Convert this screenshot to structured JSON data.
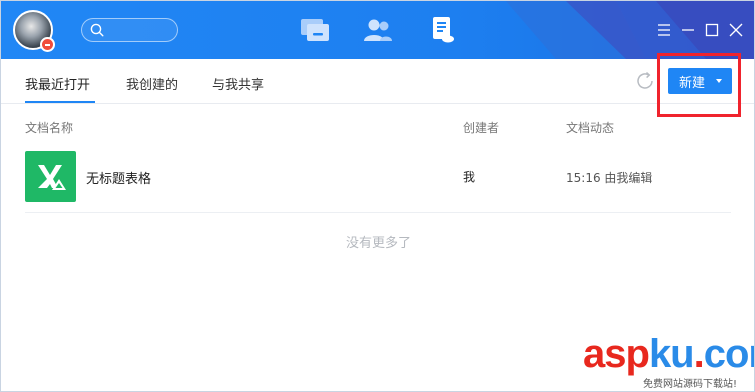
{
  "header": {
    "search": {
      "placeholder": ""
    },
    "nav": [
      {
        "icon": "message-icon",
        "active": false
      },
      {
        "icon": "contacts-icon",
        "active": false
      },
      {
        "icon": "document-icon",
        "active": true
      }
    ],
    "window_controls": [
      "menu-icon",
      "minimize-icon",
      "maximize-icon",
      "close-icon"
    ]
  },
  "tabs": [
    {
      "label": "我最近打开",
      "active": true
    },
    {
      "label": "我创建的",
      "active": false
    },
    {
      "label": "与我共享",
      "active": false
    }
  ],
  "toolbar": {
    "new_label": "新建"
  },
  "table": {
    "columns": [
      "文档名称",
      "创建者",
      "文档动态"
    ],
    "rows": [
      {
        "icon": "spreadsheet-icon",
        "name": "无标题表格",
        "creator": "我",
        "activity": "15:16 由我编辑"
      }
    ],
    "footer": "没有更多了"
  },
  "watermark": {
    "text_asp": "asp",
    "text_ku": "ku",
    "text_dot": ".",
    "text_com": "com",
    "subtitle": "免费网站源码下载站!"
  },
  "colors": {
    "titlebar": "#1f86f5",
    "accent": "#1f86f5",
    "file_icon": "#1fb866",
    "highlight": "#f0232d",
    "watermark_red": "#e8281e",
    "watermark_blue": "#2a8be8"
  }
}
